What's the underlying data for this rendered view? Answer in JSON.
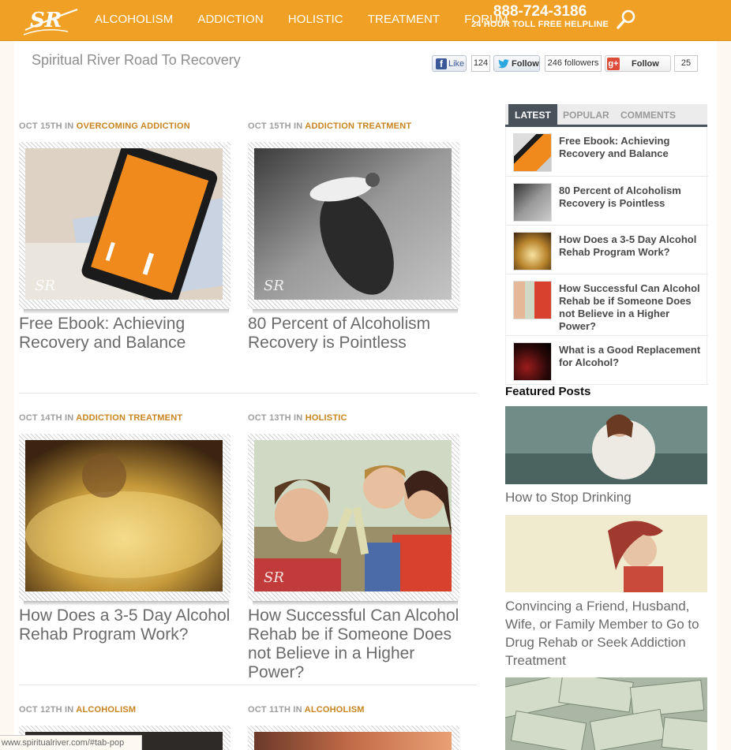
{
  "header": {
    "nav": [
      "ALCOHOLISM",
      "ADDICTION",
      "HOLISTIC",
      "TREATMENT",
      "FORUM"
    ],
    "phone": "888-724-3186",
    "phone_sub": "24 HOUR TOLL FREE HELPLINE",
    "logo_text": "SR"
  },
  "site_title": "Spiritual River Road To Recovery",
  "social": {
    "fb_like": "Like",
    "fb_count": "124",
    "tw_follow": "Follow",
    "tw_count": "246 followers",
    "gp_label": "g+",
    "gp_follow": "Follow",
    "gp_count": "25"
  },
  "posts": [
    {
      "date": "OCT 15TH IN",
      "category": "OVERCOMING ADDICTION",
      "title": "Free Ebook: Achieving Recovery and Balance"
    },
    {
      "date": "OCT 15TH IN",
      "category": "ADDICTION TREATMENT",
      "title": "80 Percent of Alcoholism Recovery is Pointless"
    },
    {
      "date": "OCT 14TH IN",
      "category": "ADDICTION TREATMENT",
      "title": "How Does a 3-5 Day Alcohol Rehab Program Work?"
    },
    {
      "date": "OCT 13TH IN",
      "category": "HOLISTIC",
      "title": "How Successful Can Alcohol Rehab be if Someone Does not Believe in a Higher Power?"
    },
    {
      "date": "OCT 12TH IN",
      "category": "ALCOHOLISM",
      "title": ""
    },
    {
      "date": "OCT 11TH IN",
      "category": "ALCOHOLISM",
      "title": ""
    }
  ],
  "sidebar": {
    "tabs": [
      "LATEST",
      "POPULAR",
      "COMMENTS"
    ],
    "latest": [
      "Free Ebook: Achieving Recovery and Balance",
      "80 Percent of Alcoholism Recovery is Pointless",
      "How Does a 3-5 Day Alcohol Rehab Program Work?",
      "How Successful Can Alcohol Rehab be if Someone Does not Believe in a Higher Power?",
      "What is a Good Replacement for Alcohol?"
    ],
    "featured_heading": "Featured Posts",
    "featured": [
      "How to Stop Drinking",
      "Convincing a Friend, Husband, Wife, or Family Member to Go to Drug Rehab or Seek Addiction Treatment"
    ]
  },
  "status_url": "www.spiritualriver.com/#tab-pop",
  "colors": {
    "header": "#f0a125",
    "category": "#c8841f",
    "tab_dark": "#49515a"
  }
}
